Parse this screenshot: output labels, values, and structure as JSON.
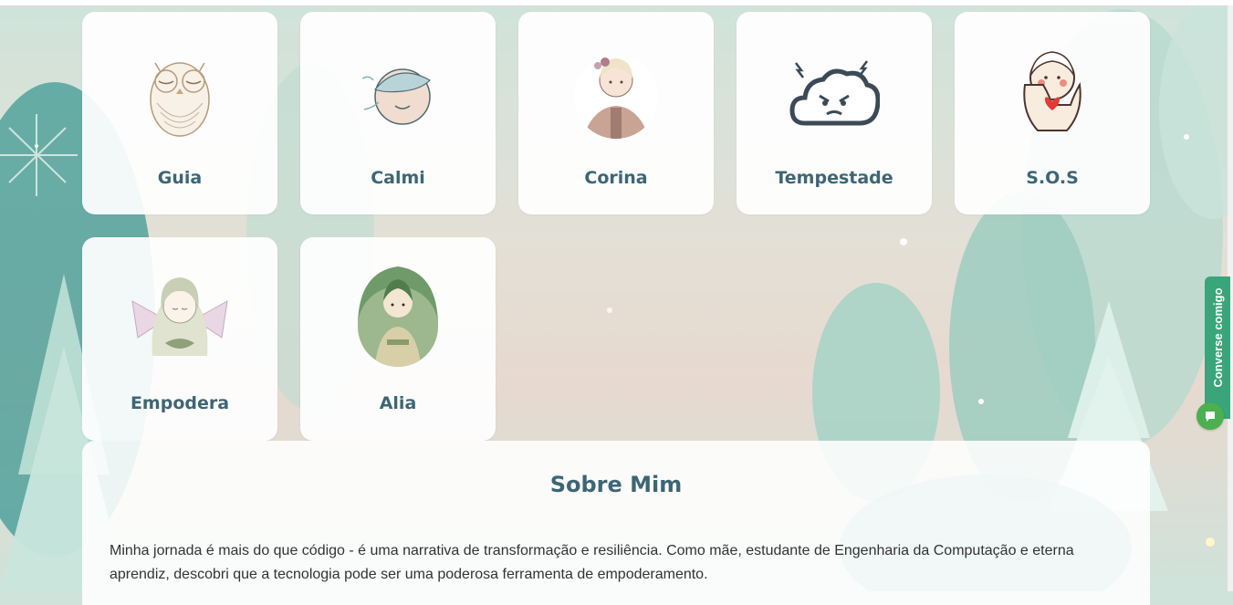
{
  "cards": [
    {
      "label": "Guia",
      "icon": "owl-icon"
    },
    {
      "label": "Calmi",
      "icon": "calm-face-icon"
    },
    {
      "label": "Corina",
      "icon": "flower-girl-icon"
    },
    {
      "label": "Tempestade",
      "icon": "storm-cloud-icon"
    },
    {
      "label": "S.O.S",
      "icon": "sos-heart-hands-icon"
    },
    {
      "label": "Empodera",
      "icon": "fairy-icon"
    },
    {
      "label": "Alia",
      "icon": "forest-woman-icon"
    }
  ],
  "about": {
    "title": "Sobre Mim",
    "text": "Minha jornada é mais do que código - é uma narrativa de transformação e resiliência. Como mãe, estudante de Engenharia da Computação e eterna aprendiz, descobri que a tecnologia pode ser uma poderosa ferramenta de empoderamento."
  },
  "chat": {
    "label": "Converse comigo"
  },
  "colors": {
    "accent": "#3d6675",
    "chat": "#3aa57a"
  }
}
